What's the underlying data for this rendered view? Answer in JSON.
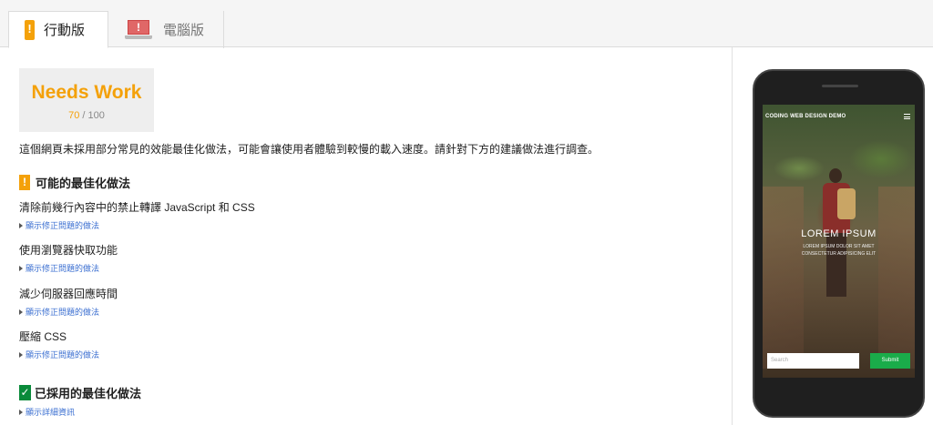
{
  "tabs": [
    {
      "label": "行動版",
      "active": true,
      "icon": "mobile-warning-icon"
    },
    {
      "label": "電腦版",
      "active": false,
      "icon": "desktop-warning-icon"
    }
  ],
  "score": {
    "verdict": "Needs Work",
    "value": "70",
    "max": "/ 100"
  },
  "summary": "這個網頁未採用部分常見的效能最佳化做法，可能會讓使用者體驗到較慢的載入速度。請針對下方的建議做法進行調查。",
  "possible": {
    "heading": "可能的最佳化做法",
    "icon": "!",
    "rules": [
      {
        "title": "清除前幾行內容中的禁止轉譯 JavaScript 和 CSS",
        "link": "顯示修正問題的做法"
      },
      {
        "title": "使用瀏覽器快取功能",
        "link": "顯示修正問題的做法"
      },
      {
        "title": "減少伺服器回應時間",
        "link": "顯示修正問題的做法"
      },
      {
        "title": "壓縮 CSS",
        "link": "顯示修正問題的做法"
      }
    ]
  },
  "passed": {
    "heading": "已採用的最佳化做法",
    "icon": "✓",
    "link": "顯示詳細資訊"
  },
  "preview": {
    "brand": "CODING WEB DESIGN DEMO",
    "hero_title": "LOREM IPSUM",
    "hero_sub_1": "LOREM IPSUM DOLOR SIT AMET",
    "hero_sub_2": "CONSECTETUR ADIPISICING ELIT",
    "search_placeholder": "Search",
    "submit_label": "Submit"
  },
  "colors": {
    "warning": "#f4a10a",
    "pass": "#0a8a3a",
    "link": "#3b6fd1",
    "submit": "#1aac4a"
  }
}
